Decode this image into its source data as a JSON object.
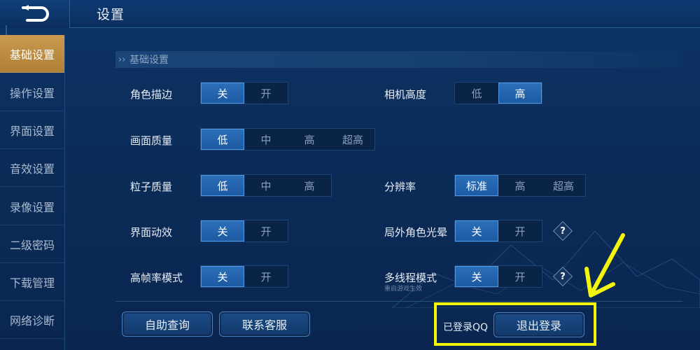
{
  "header": {
    "title": "设置"
  },
  "sidebar": {
    "items": [
      {
        "label": "基础设置",
        "active": true
      },
      {
        "label": "操作设置",
        "active": false
      },
      {
        "label": "界面设置",
        "active": false
      },
      {
        "label": "音效设置",
        "active": false
      },
      {
        "label": "录像设置",
        "active": false
      },
      {
        "label": "二级密码",
        "active": false
      },
      {
        "label": "下载管理",
        "active": false
      },
      {
        "label": "网络诊断",
        "active": false
      }
    ]
  },
  "section": {
    "title": "基础设置"
  },
  "settings": {
    "outline": {
      "label": "角色描边",
      "options": [
        "关",
        "开"
      ],
      "selected": "关"
    },
    "camera_height": {
      "label": "相机高度",
      "options": [
        "低",
        "高"
      ],
      "selected": "高"
    },
    "graphics_quality": {
      "label": "画面质量",
      "options": [
        "低",
        "中",
        "高",
        "超高"
      ],
      "selected": "低"
    },
    "particle_quality": {
      "label": "粒子质量",
      "options": [
        "低",
        "中",
        "高"
      ],
      "selected": "低"
    },
    "resolution": {
      "label": "分辨率",
      "options": [
        "标准",
        "高",
        "超高"
      ],
      "selected": "标准"
    },
    "ui_animation": {
      "label": "界面动效",
      "options": [
        "关",
        "开"
      ],
      "selected": "关"
    },
    "outside_glow": {
      "label": "局外角色光晕",
      "options": [
        "关",
        "开"
      ],
      "selected": "关",
      "help": "?"
    },
    "high_fps": {
      "label": "高帧率模式",
      "options": [
        "关",
        "开"
      ],
      "selected": "关"
    },
    "multithread": {
      "label": "多线程模式",
      "sublabel": "重启游戏生效",
      "options": [
        "关",
        "开"
      ],
      "selected": "关",
      "help": "?"
    }
  },
  "footer": {
    "self_help_label": "自助查询",
    "contact_label": "联系客服",
    "logged_text": "已登录QQ",
    "logout_label": "退出登录"
  },
  "colors": {
    "accent": "#2b6fb8",
    "sidebar_active": "#c89a4e",
    "annotation": "#f5f50c",
    "background": "#0c2a55"
  }
}
